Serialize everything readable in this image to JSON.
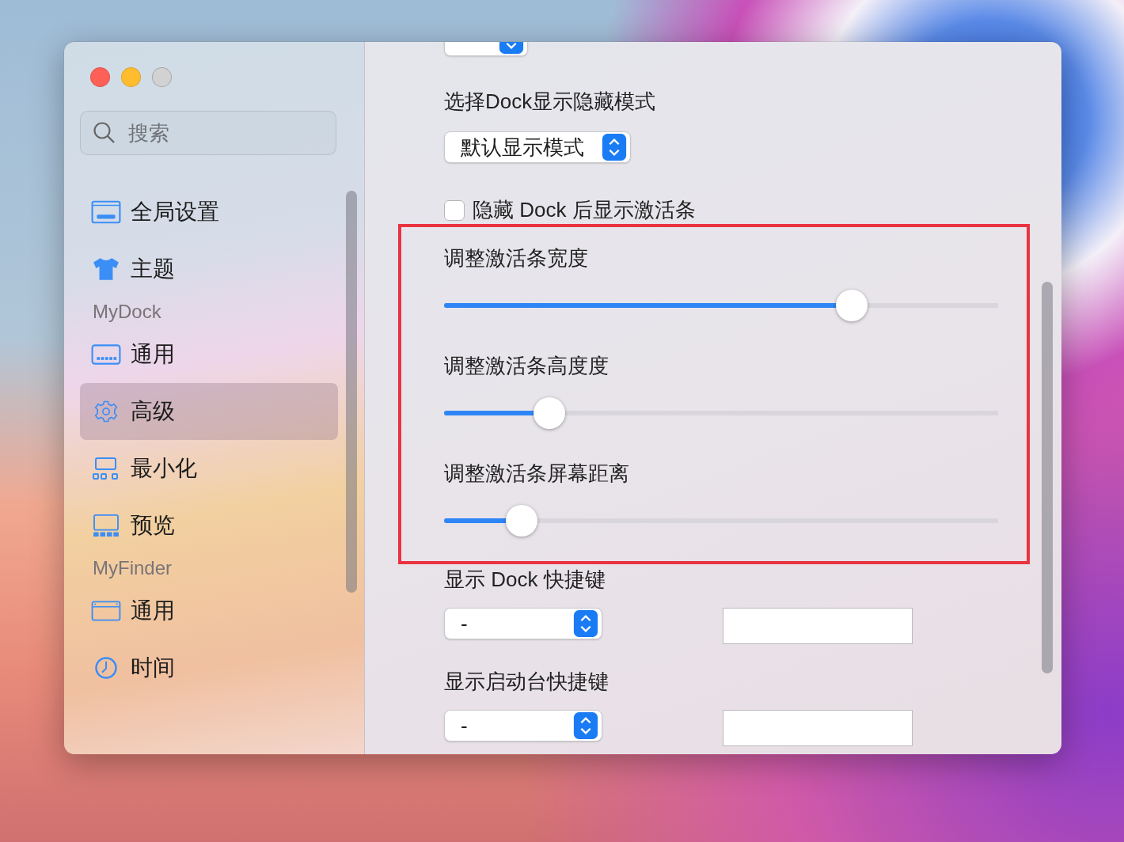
{
  "window": {
    "controls": [
      {
        "kind": "close",
        "color": "#fe5f57"
      },
      {
        "kind": "minimize",
        "color": "#febc2e"
      },
      {
        "kind": "zoom",
        "color": "#d2d2d2"
      }
    ]
  },
  "sidebar": {
    "search": {
      "placeholder": "搜索"
    },
    "items": [
      {
        "kind": "item",
        "label": "全局设置",
        "selected": false
      },
      {
        "kind": "item",
        "label": "主题",
        "selected": false
      },
      {
        "kind": "header",
        "label": "MyDock"
      },
      {
        "kind": "item",
        "label": "通用",
        "selected": false
      },
      {
        "kind": "item",
        "label": "高级",
        "selected": true
      },
      {
        "kind": "item",
        "label": "最小化",
        "selected": false
      },
      {
        "kind": "item",
        "label": "预览",
        "selected": false
      },
      {
        "kind": "header",
        "label": "MyFinder"
      },
      {
        "kind": "item",
        "label": "通用",
        "selected": false
      },
      {
        "kind": "item",
        "label": "时间",
        "selected": false
      }
    ]
  },
  "content": {
    "hide_mode": {
      "label": "选择Dock显示隐藏模式",
      "value": "默认显示模式"
    },
    "show_bar_after_hide": {
      "label": "隐藏 Dock 后显示激活条",
      "checked": false
    },
    "highlighted_sliders": [
      {
        "label": "调整激活条宽度",
        "level": 0.736
      },
      {
        "label": "调整激活条高度度",
        "level": 0.19
      },
      {
        "label": "调整激活条屏幕距离",
        "level": 0.14
      }
    ],
    "shortcuts": [
      {
        "label": "显示 Dock 快捷键",
        "value": "-"
      },
      {
        "label": "显示启动台快捷键",
        "value": "-"
      }
    ]
  }
}
